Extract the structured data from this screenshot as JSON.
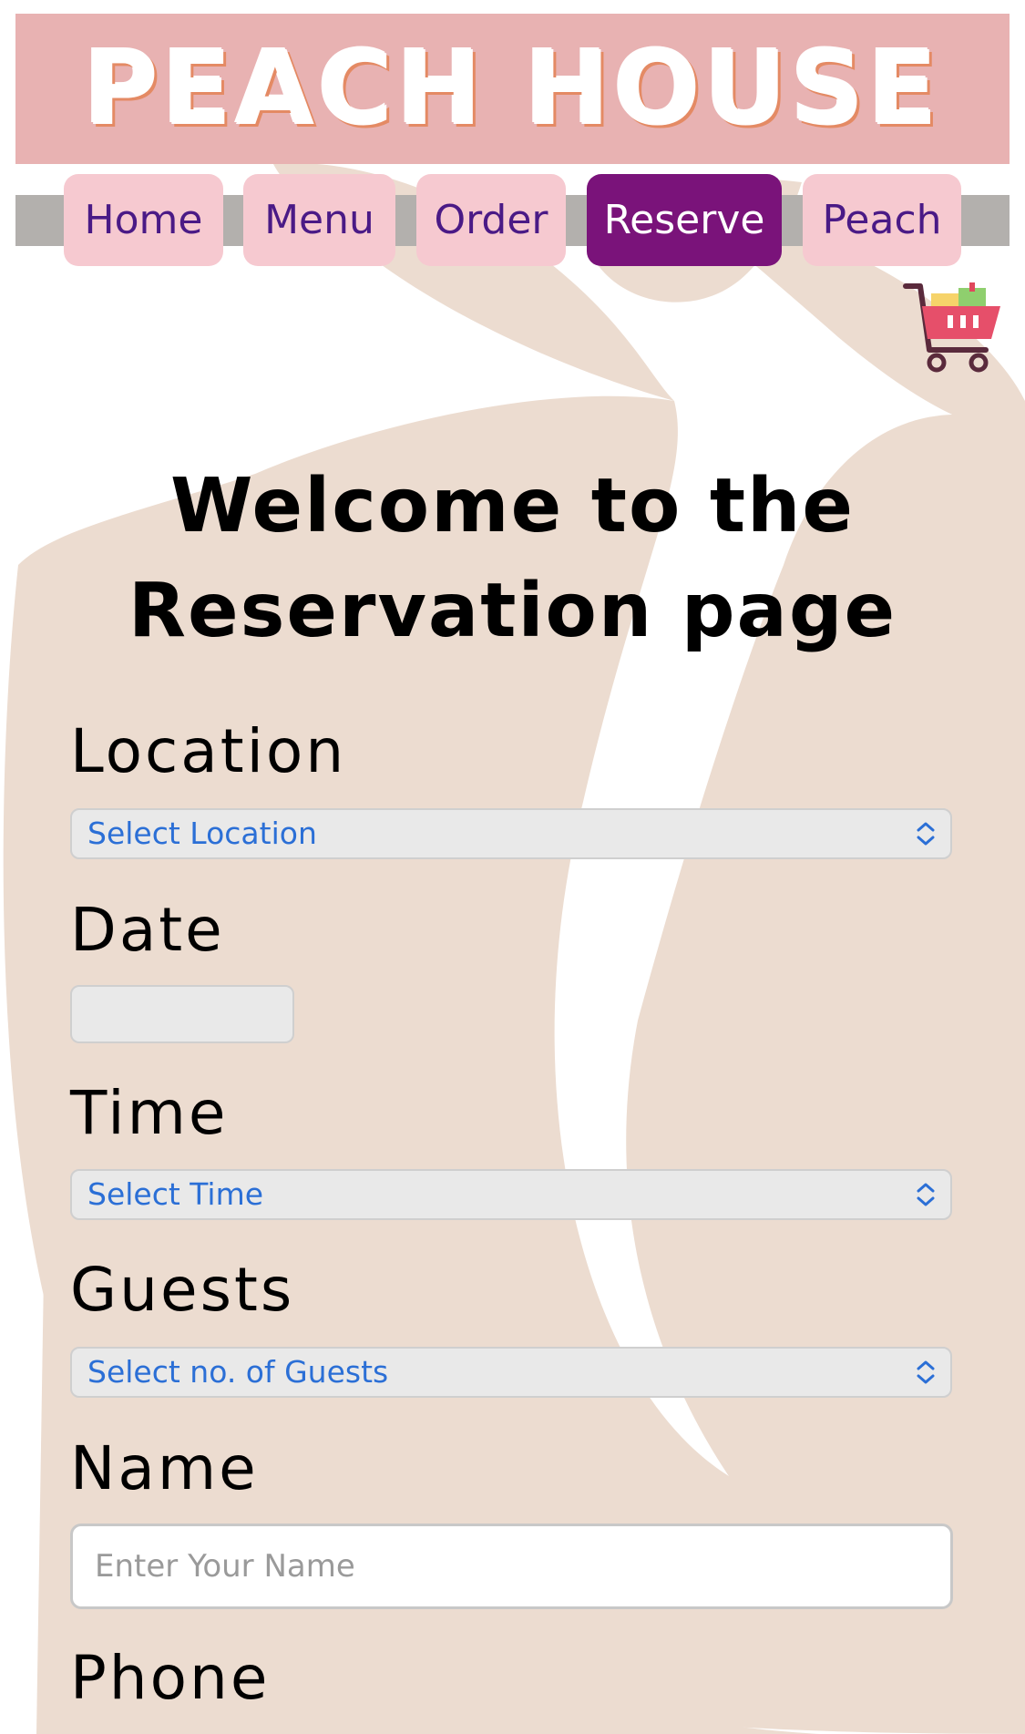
{
  "banner": {
    "title": "PEACH HOUSE"
  },
  "nav": {
    "items": [
      {
        "label": "Home"
      },
      {
        "label": "Menu"
      },
      {
        "label": "Order"
      },
      {
        "label": "Reserve"
      },
      {
        "label": "Peach"
      }
    ],
    "active": "Reserve"
  },
  "cart": {
    "icon": "shopping-cart-icon"
  },
  "page": {
    "heading_line1": "Welcome to the",
    "heading_line2": "Reservation page"
  },
  "form": {
    "location": {
      "label": "Location",
      "value": "Select Location"
    },
    "date": {
      "label": "Date",
      "value": ""
    },
    "time": {
      "label": "Time",
      "value": "Select Time"
    },
    "guests": {
      "label": "Guests",
      "value": "Select no. of Guests"
    },
    "name": {
      "label": "Name",
      "placeholder": "Enter Your Name"
    },
    "phone": {
      "label": "Phone"
    }
  },
  "colors": {
    "banner": "#e8b2b2",
    "nav_inactive": "#f6c9d0",
    "nav_active": "#7a137a",
    "nav_text": "#4a1a86",
    "select_text": "#2b6fd6",
    "peach_bg": "#ecdcd0"
  }
}
